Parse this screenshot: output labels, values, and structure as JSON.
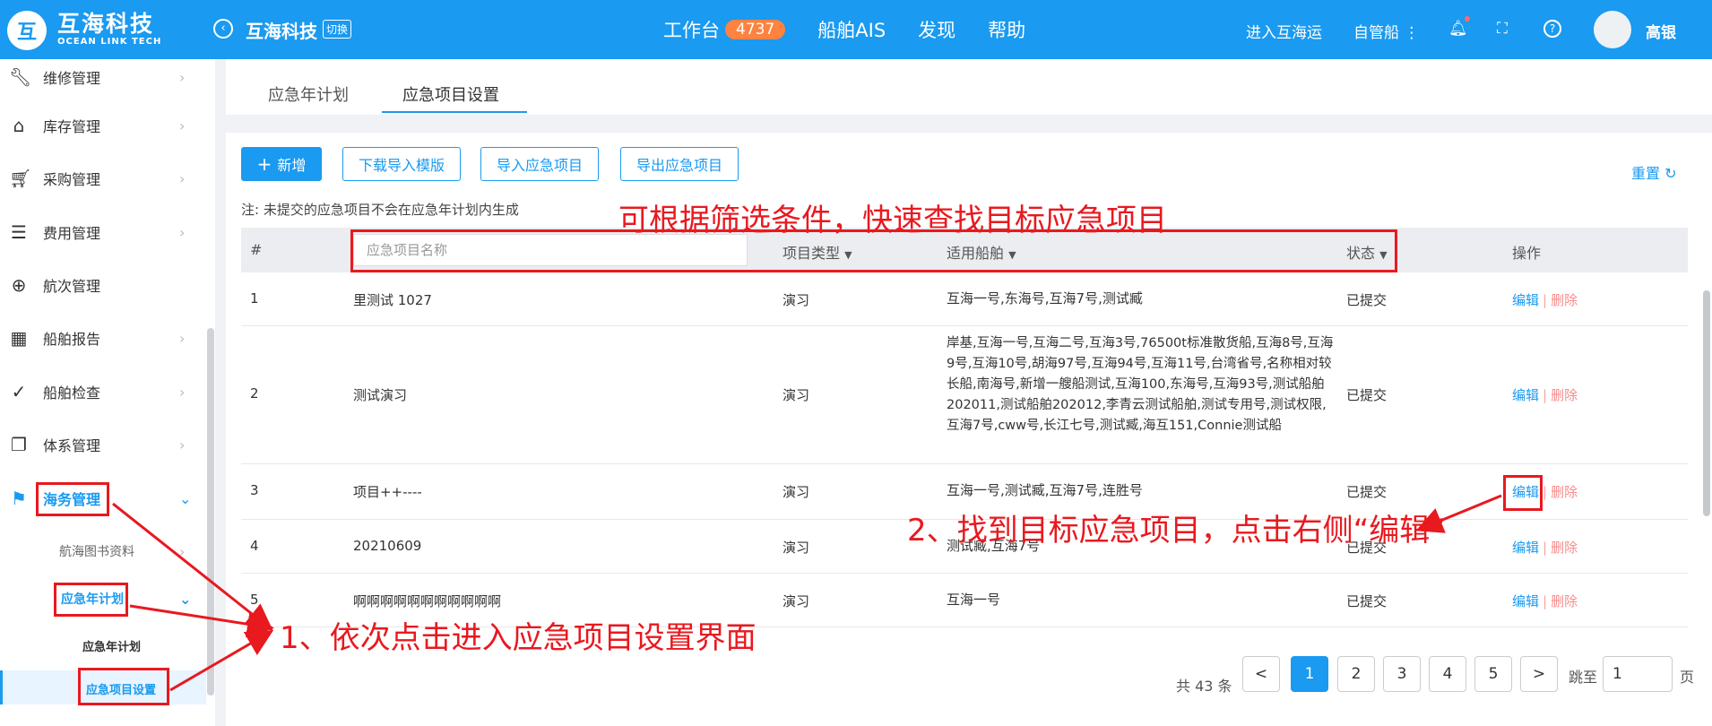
{
  "header": {
    "logo_mark": "互",
    "logo_cn": "互海科技",
    "logo_en": "OCEAN LINK TECH",
    "company": "互海科技",
    "switch_label": "切换",
    "nav": {
      "workbench": "工作台",
      "badge": "4737",
      "ais": "船舶AIS",
      "discover": "发现",
      "help": "帮助"
    },
    "enter_link": "进入互海运",
    "ship_mode": "自管船",
    "user_name": "高银"
  },
  "sidebar": {
    "items": [
      {
        "label": "维修管理",
        "icon": "wrench-icon"
      },
      {
        "label": "库存管理",
        "icon": "home-icon"
      },
      {
        "label": "采购管理",
        "icon": "cart-icon"
      },
      {
        "label": "费用管理",
        "icon": "coins-icon"
      },
      {
        "label": "航次管理",
        "icon": "globe-icon"
      },
      {
        "label": "船舶报告",
        "icon": "calendar-icon"
      },
      {
        "label": "船舶检查",
        "icon": "check-circle-icon"
      },
      {
        "label": "体系管理",
        "icon": "document-icon"
      },
      {
        "label": "海务管理",
        "icon": "signpost-icon"
      }
    ],
    "sub": {
      "charts": "航海图书资料",
      "plan": "应急年计划",
      "plan_item": "应急年计划",
      "settings": "应急项目设置"
    }
  },
  "tabs": [
    "应急年计划",
    "应急项目设置"
  ],
  "toolbar": {
    "add": "新增",
    "download": "下载导入模版",
    "import": "导入应急项目",
    "export": "导出应急项目",
    "reset": "重置",
    "note": "注: 未提交的应急项目不会在应急年计划内生成"
  },
  "table": {
    "headers": {
      "index": "#",
      "search_placeholder": "应急项目名称",
      "type": "项目类型",
      "ships": "适用船舶",
      "status": "状态",
      "ops": "操作"
    },
    "edit": "编辑",
    "delete": "删除",
    "rows": [
      {
        "index": "1",
        "name": "里测试 1027",
        "type": "演习",
        "ships": "互海一号,东海号,互海7号,测试臧",
        "status": "已提交"
      },
      {
        "index": "2",
        "name": "测试演习",
        "type": "演习",
        "ships": "岸基,互海一号,互海二号,互海3号,76500t标准散货船,互海8号,互海9号,互海10号,胡海97号,互海94号,互海11号,台湾省号,名称相对较长船,南海号,新增一艘船测试,互海100,东海号,互海93号,测试船舶202011,测试船舶202012,李青云测试船舶,测试专用号,测试权限,互海7号,cww号,长江七号,测试臧,海互151,Connie测试船",
        "status": "已提交"
      },
      {
        "index": "3",
        "name": "项目++----",
        "type": "演习",
        "ships": "互海一号,测试臧,互海7号,连胜号",
        "status": "已提交"
      },
      {
        "index": "4",
        "name": "20210609",
        "type": "演习",
        "ships": "测试臧,互海7号",
        "status": "已提交"
      },
      {
        "index": "5",
        "name": "啊啊啊啊啊啊啊啊啊啊啊",
        "type": "演习",
        "ships": "互海一号",
        "status": "已提交"
      }
    ]
  },
  "pagination": {
    "total": "共 43 条",
    "prev": "<",
    "next": ">",
    "pages": [
      "1",
      "2",
      "3",
      "4",
      "5"
    ],
    "current": "1",
    "jump_label": "跳至",
    "jump_value": "1",
    "page_unit": "页"
  },
  "annotations": {
    "filter_tip": "可根据筛选条件，快速查找目标应急项目",
    "step1": "1、依次点击进入应急项目设置界面",
    "step2": "2、找到目标应急项目，点击右侧“编辑”"
  }
}
